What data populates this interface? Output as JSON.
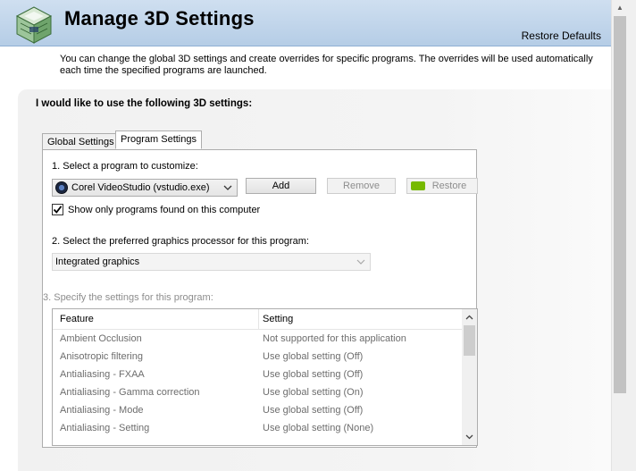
{
  "header": {
    "title": "Manage 3D Settings",
    "restore_defaults": "Restore Defaults"
  },
  "description": "You can change the global 3D settings and create overrides for specific programs. The overrides will be used automatically each time the specified programs are launched.",
  "panel": {
    "heading": "I would like to use the following 3D settings:"
  },
  "tabs": [
    {
      "label": "Global Settings",
      "active": false
    },
    {
      "label": "Program Settings",
      "active": true
    }
  ],
  "program_settings": {
    "step1_label": "1. Select a program to customize:",
    "selected_program": "Corel VideoStudio (vstudio.exe)",
    "add_button": "Add",
    "remove_button": "Remove",
    "restore_button": "Restore",
    "show_only_checkbox": {
      "label": "Show only programs found on this computer",
      "checked": true
    },
    "step2_label": "2. Select the preferred graphics processor for this program:",
    "selected_gpu": "Integrated graphics",
    "step3_label": "3. Specify the settings for this program:",
    "table": {
      "columns": [
        "Feature",
        "Setting"
      ],
      "rows": [
        {
          "feature": "Ambient Occlusion",
          "setting": "Not supported for this application"
        },
        {
          "feature": "Anisotropic filtering",
          "setting": "Use global setting (Off)"
        },
        {
          "feature": "Antialiasing - FXAA",
          "setting": "Use global setting (Off)"
        },
        {
          "feature": "Antialiasing - Gamma correction",
          "setting": "Use global setting (On)"
        },
        {
          "feature": "Antialiasing - Mode",
          "setting": "Use global setting (Off)"
        },
        {
          "feature": "Antialiasing - Setting",
          "setting": "Use global setting (None)"
        }
      ]
    }
  },
  "colors": {
    "header_bg": "#c3d6ec",
    "nvidia_green": "#76b900",
    "disabled_text": "#8d8d8d"
  }
}
